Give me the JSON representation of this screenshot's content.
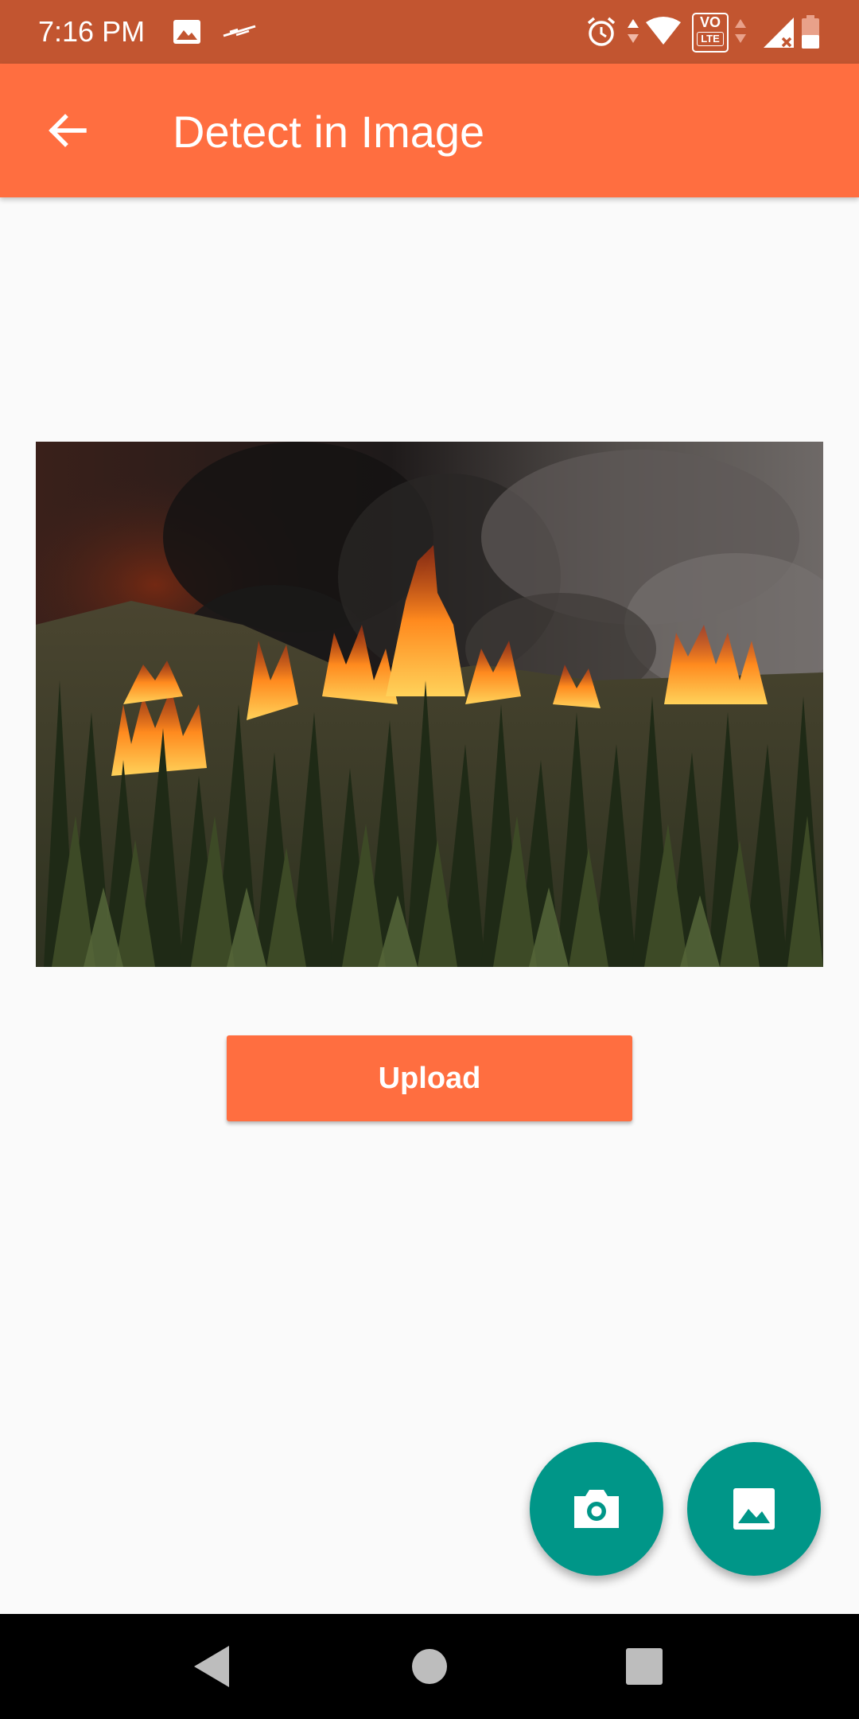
{
  "status_bar": {
    "time": "7:16 PM",
    "left_icons": [
      "image-notification-icon",
      "app-notification-icon"
    ],
    "right_icons": [
      "alarm-icon",
      "data-arrows-icon",
      "wifi-icon",
      "volte-icon",
      "signal-icon",
      "battery-icon"
    ],
    "volte_label": "VO",
    "lte_label": "LTE",
    "background": "#c25530"
  },
  "app_bar": {
    "title": "Detect in Image",
    "back_icon": "arrow-back-icon",
    "background": "#ff6e40"
  },
  "main": {
    "image_subject": "forest fire",
    "upload_label": "Upload",
    "accent": "#ff6e40"
  },
  "fabs": [
    {
      "icon": "camera-icon",
      "color": "#009688"
    },
    {
      "icon": "gallery-icon",
      "color": "#009688"
    }
  ],
  "nav_bar": {
    "buttons": [
      "back-triangle-icon",
      "home-circle-icon",
      "recents-square-icon"
    ]
  }
}
